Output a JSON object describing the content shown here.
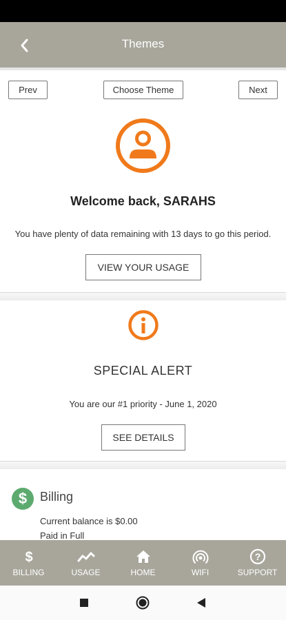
{
  "header": {
    "title": "Themes"
  },
  "theme_nav": {
    "prev_label": "Prev",
    "choose_label": "Choose Theme",
    "next_label": "Next"
  },
  "welcome": {
    "title": "Welcome back, SARAHS",
    "message": "You have plenty of data remaining with 13 days to go this period.",
    "button_label": "VIEW YOUR USAGE"
  },
  "alert": {
    "title": "SPECIAL ALERT",
    "message": "You are our #1 priority - June 1, 2020",
    "button_label": "SEE DETAILS"
  },
  "billing": {
    "title": "Billing",
    "balance_text": "Current balance is $0.00",
    "status_text": "Paid in Full"
  },
  "bottom_nav": {
    "items": [
      {
        "label": "BILLING",
        "icon": "dollar-icon"
      },
      {
        "label": "USAGE",
        "icon": "trend-icon"
      },
      {
        "label": "HOME",
        "icon": "home-icon"
      },
      {
        "label": "WIFI",
        "icon": "wifi-icon"
      },
      {
        "label": "SUPPORT",
        "icon": "help-icon"
      }
    ]
  },
  "colors": {
    "header_bg": "#a8a69b",
    "accent_orange": "#f07a1b",
    "billing_green": "#5daa6f"
  }
}
